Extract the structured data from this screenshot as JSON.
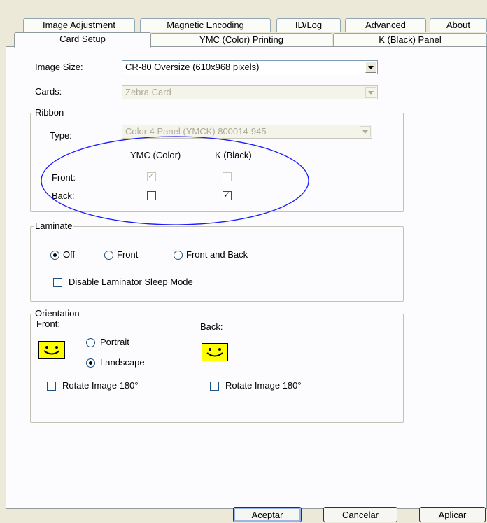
{
  "tabs_back": [
    "Image Adjustment",
    "Magnetic Encoding",
    "ID/Log",
    "Advanced",
    "About"
  ],
  "tabs_front": [
    "Card Setup",
    "YMC (Color) Printing",
    "K (Black) Panel"
  ],
  "image_size": {
    "label": "Image Size:",
    "value": "CR-80 Oversize (610x968 pixels)"
  },
  "cards": {
    "label": "Cards:",
    "value": "Zebra Card"
  },
  "ribbon": {
    "legend": "Ribbon",
    "type_label": "Type:",
    "type_value": "Color 4 Panel (YMCK) 800014-945",
    "col_ymc": "YMC (Color)",
    "col_k": "K (Black)",
    "front_label": "Front:",
    "back_label": "Back:",
    "front_ymc_checked": true,
    "front_k_checked": false,
    "back_ymc_checked": false,
    "back_k_checked": true
  },
  "laminate": {
    "legend": "Laminate",
    "options": [
      "Off",
      "Front",
      "Front and Back"
    ],
    "selected": "Off",
    "sleep_label": "Disable Laminator Sleep Mode"
  },
  "orientation": {
    "legend": "Orientation",
    "front_label": "Front:",
    "back_label": "Back:",
    "portrait": "Portrait",
    "landscape": "Landscape",
    "selected": "Landscape",
    "rotate_front": "Rotate Image 180°",
    "rotate_back": "Rotate Image 180°"
  },
  "buttons": {
    "ok": "Aceptar",
    "cancel": "Cancelar",
    "apply": "Aplicar"
  },
  "colors": {
    "annotation_ellipse": "#1a1aff",
    "smiley": "#ffff00"
  }
}
